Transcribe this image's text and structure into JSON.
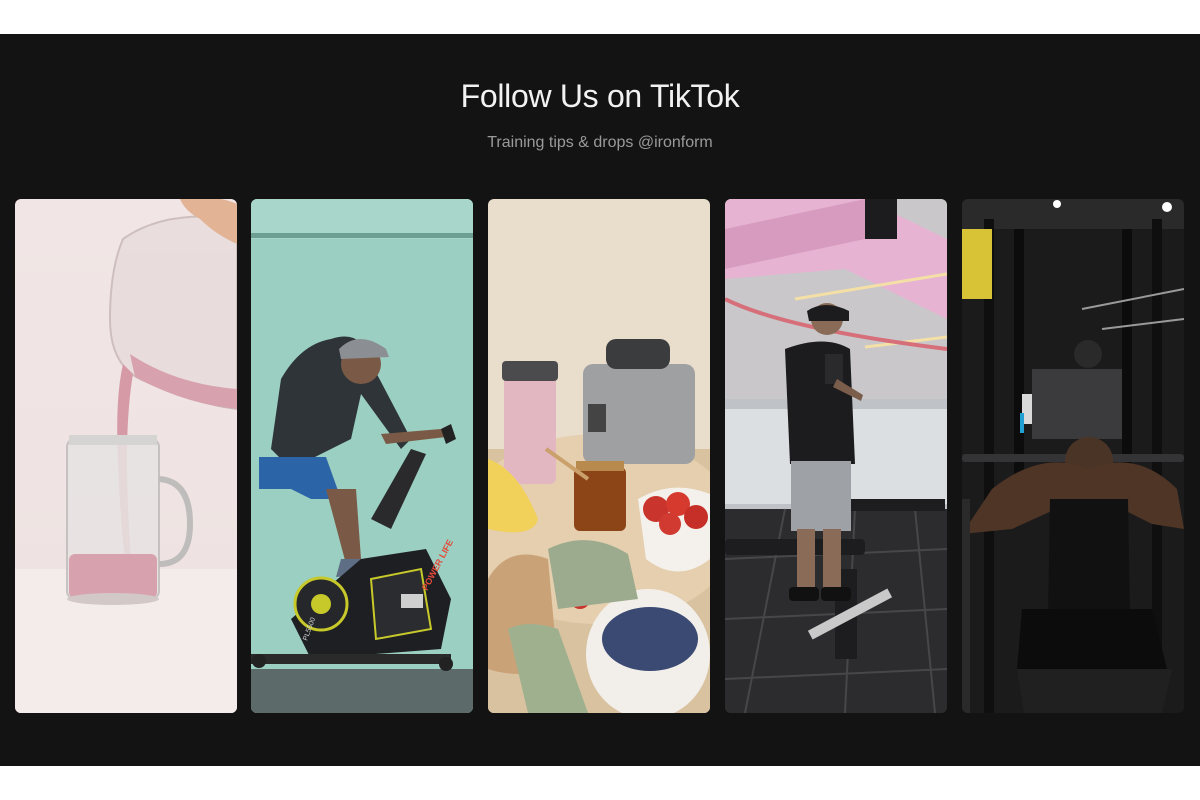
{
  "section": {
    "title": "Follow Us on TikTok",
    "subtitle": "Training tips & drops @ironform"
  },
  "tiles": [
    {
      "name": "smoothie-pour",
      "bike_brand": ""
    },
    {
      "name": "spin-bike-rider",
      "bike_brand": "POWER LIFE",
      "bike_model": "PL5500"
    },
    {
      "name": "breakfast-spread"
    },
    {
      "name": "gym-dumbbell"
    },
    {
      "name": "lat-pulldown"
    }
  ],
  "colors": {
    "section_bg": "#131313",
    "title": "#f2f2f2",
    "subtitle": "#9a9a9a"
  }
}
